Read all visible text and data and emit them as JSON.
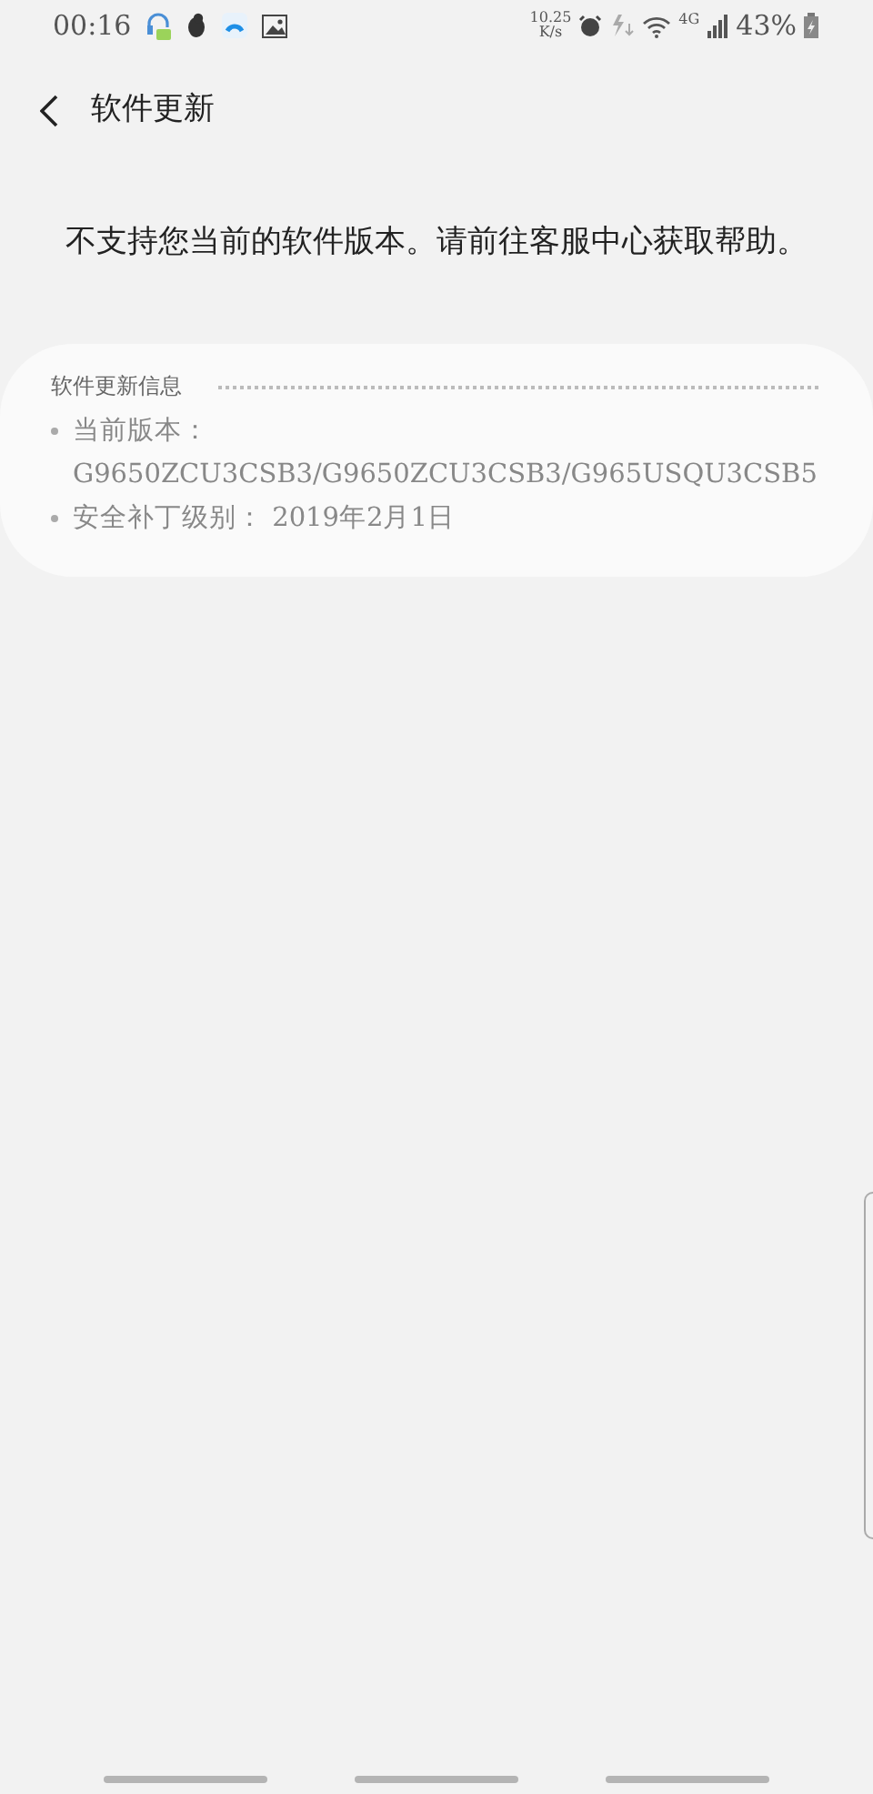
{
  "status_bar": {
    "time": "00:16",
    "network_speed": "10.25",
    "speed_unit": "K/s",
    "network_type": "4G",
    "battery": "43%"
  },
  "header": {
    "title": "软件更新"
  },
  "message": "不支持您当前的软件版本。请前往客服中心获取帮助。",
  "info": {
    "title": "软件更新信息",
    "items": [
      {
        "text": "当前版本：G9650ZCU3CSB3/G9650ZCU3CSB3/G965USQU3CSB5"
      },
      {
        "text": "安全补丁级别： 2019年2月1日"
      }
    ]
  }
}
